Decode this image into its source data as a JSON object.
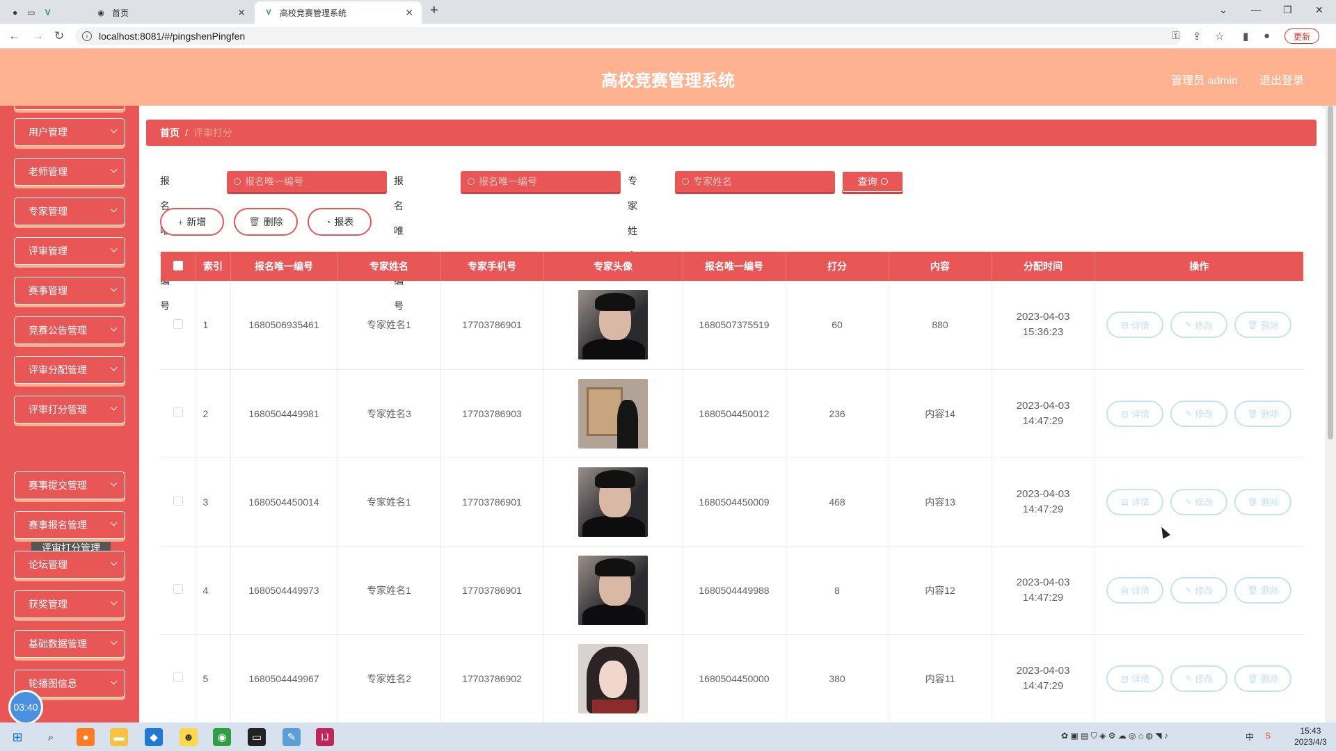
{
  "browser": {
    "tabs": [
      {
        "label": "首页"
      },
      {
        "label": "高校竞赛管理系统"
      }
    ],
    "url": "localhost:8081/#/pingshenPingfen",
    "update_label": "更新"
  },
  "header": {
    "title": "高校竞赛管理系统",
    "user": "管理员 admin",
    "logout": "退出登录"
  },
  "sidebar": {
    "items": [
      {
        "label": "用户管理"
      },
      {
        "label": "老师管理"
      },
      {
        "label": "专家管理"
      },
      {
        "label": "评审管理"
      },
      {
        "label": "赛事管理"
      },
      {
        "label": "竞赛公告管理"
      },
      {
        "label": "评审分配管理"
      },
      {
        "label": "评审打分管理"
      },
      {
        "label": "赛事提交管理"
      },
      {
        "label": "赛事报名管理"
      },
      {
        "label": "论坛管理"
      },
      {
        "label": "获奖管理"
      },
      {
        "label": "基础数据管理"
      },
      {
        "label": "轮播图信息"
      }
    ],
    "submenu": "评审打分管理",
    "timer": "03:40"
  },
  "breadcrumb": {
    "home": "首页",
    "sep": "/",
    "current": "评审打分"
  },
  "search": {
    "label1": "报名唯一编号",
    "placeholder1": "报名唯一编号",
    "label2": "报名唯一编号",
    "placeholder2": "报名唯一编号",
    "label3": "专家姓名",
    "placeholder3": "专家姓名",
    "query": "查询"
  },
  "actions": {
    "add": "新增",
    "delete": "删除",
    "report": "报表"
  },
  "table": {
    "headers": [
      "索引",
      "报名唯一编号",
      "专家姓名",
      "专家手机号",
      "专家头像",
      "报名唯一编号",
      "打分",
      "内容",
      "分配时间",
      "操作"
    ],
    "rows": [
      {
        "index": "1",
        "signup_no": "1680506935461",
        "expert_name": "专家姓名1",
        "phone": "17703786901",
        "avatar": "male",
        "signup_no2": "1680507375519",
        "score": "60",
        "content": "880",
        "time": "2023-04-03 15:36:23"
      },
      {
        "index": "2",
        "signup_no": "1680504449981",
        "expert_name": "专家姓名3",
        "phone": "17703786903",
        "avatar": "painting",
        "signup_no2": "1680504450012",
        "score": "236",
        "content": "内容14",
        "time": "2023-04-03 14:47:29"
      },
      {
        "index": "3",
        "signup_no": "1680504450014",
        "expert_name": "专家姓名1",
        "phone": "17703786901",
        "avatar": "male",
        "signup_no2": "1680504450009",
        "score": "468",
        "content": "内容13",
        "time": "2023-04-03 14:47:29"
      },
      {
        "index": "4",
        "signup_no": "1680504449973",
        "expert_name": "专家姓名1",
        "phone": "17703786901",
        "avatar": "male",
        "signup_no2": "1680504449988",
        "score": "8",
        "content": "内容12",
        "time": "2023-04-03 14:47:29"
      },
      {
        "index": "5",
        "signup_no": "1680504449967",
        "expert_name": "专家姓名2",
        "phone": "17703786902",
        "avatar": "female",
        "signup_no2": "1680504450000",
        "score": "380",
        "content": "内容11",
        "time": "2023-04-03 14:47:29"
      }
    ],
    "op_labels": {
      "detail": "详情",
      "edit": "修改",
      "delete": "删除"
    }
  },
  "taskbar": {
    "time": "15:43",
    "date": "2023/4/3",
    "ime": "中"
  },
  "colors": {
    "primary": "#e95656",
    "header": "#feb290",
    "op_button": "#c5e3f4"
  }
}
